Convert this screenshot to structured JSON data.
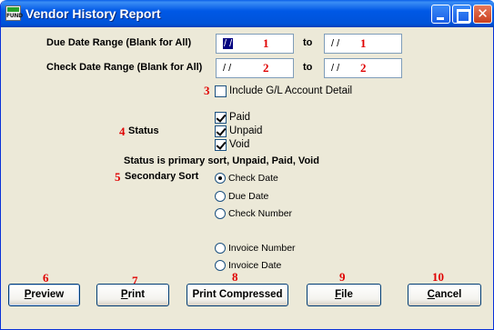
{
  "window": {
    "title": "Vendor History Report",
    "app_icon_text": "FUND"
  },
  "fields": {
    "due_date_label": "Due Date Range (Blank for All)",
    "check_date_label": "Check Date Range (Blank for All)",
    "to_label": "to",
    "due_from": "/ /",
    "due_to": "/ /",
    "check_from": "/ /",
    "check_to": "/ /"
  },
  "markers": {
    "m1": "1",
    "m2": "2",
    "m3": "3",
    "m4": "4",
    "m5": "5",
    "m6": "6",
    "m7": "7",
    "m8": "8",
    "m9": "9",
    "m10": "10"
  },
  "gl_detail": {
    "label": "Include G/L Account Detail",
    "checked": false
  },
  "status": {
    "label": "Status",
    "options": [
      {
        "label": "Paid",
        "checked": true
      },
      {
        "label": "Unpaid",
        "checked": true
      },
      {
        "label": "Void",
        "checked": true
      }
    ],
    "note": "Status is primary sort, Unpaid, Paid, Void"
  },
  "secondary_sort": {
    "label": "Secondary Sort",
    "options": [
      "Check Date",
      "Due Date",
      "Check Number",
      "Invoice Number",
      "Invoice Date"
    ],
    "selected": "Check Date"
  },
  "buttons": {
    "preview": {
      "first": "P",
      "rest": "review"
    },
    "print": {
      "first": "P",
      "rest": "rint"
    },
    "print_compressed": "Print Compressed",
    "file": {
      "first": "F",
      "rest": "ile"
    },
    "cancel": {
      "first": "C",
      "rest": "ancel"
    }
  }
}
